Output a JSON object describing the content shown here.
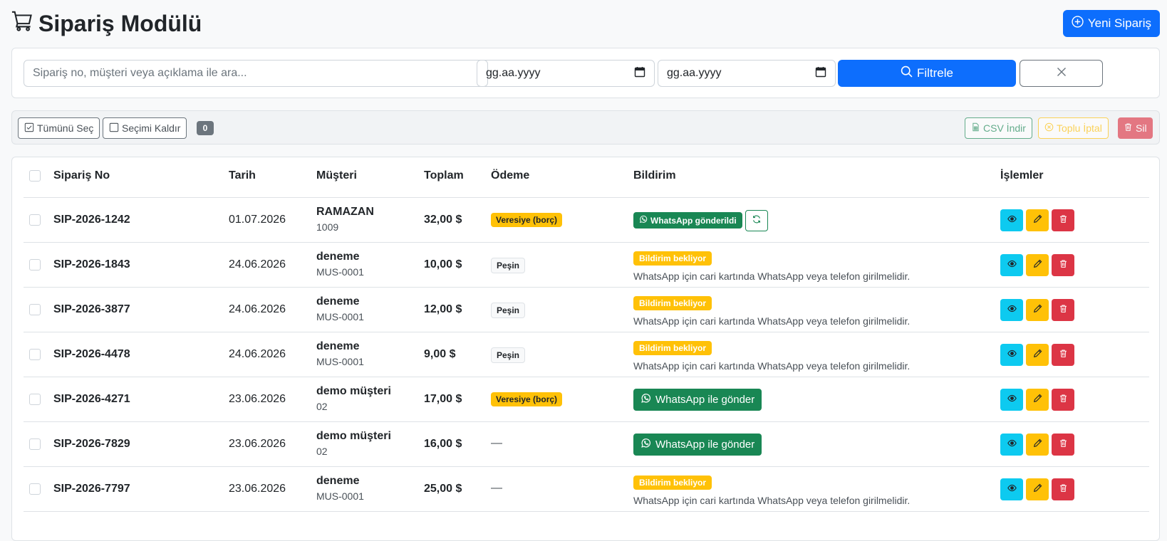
{
  "header": {
    "title": "Sipariş Modülü",
    "new_order_label": "Yeni Sipariş"
  },
  "filters": {
    "search_placeholder": "Sipariş no, müşteri veya açıklama ile ara...",
    "date_start_value": "gg.aa.yyyy",
    "date_end_value": "gg.aa.yyyy",
    "filter_label": "Filtrele"
  },
  "bulk": {
    "select_all_label": "Tümünü Seç",
    "clear_selection_label": "Seçimi Kaldır",
    "selected_count": "0",
    "csv_label": "CSV İndir",
    "bulk_cancel_label": "Toplu İptal",
    "delete_label": "Sil"
  },
  "table": {
    "columns": {
      "order_no": "Sipariş No",
      "date": "Tarih",
      "customer": "Müşteri",
      "total": "Toplam",
      "payment": "Ödeme",
      "notification": "Bildirim",
      "actions": "İşlemler"
    },
    "rows": [
      {
        "order_no": "SIP-2026-1242",
        "date": "01.07.2026",
        "customer": "RAMAZAN",
        "customer_code": "1009",
        "total": "32,00 $",
        "payment": "Veresiye (borç)",
        "payment_type": "credit",
        "notification": "WhatsApp gönderildi",
        "notification_type": "sent"
      },
      {
        "order_no": "SIP-2026-1843",
        "date": "24.06.2026",
        "customer": "deneme",
        "customer_code": "MUS-0001",
        "total": "10,00 $",
        "payment": "Peşin",
        "payment_type": "cash",
        "notification": "Bildirim bekliyor",
        "notification_help": "WhatsApp için cari kartında WhatsApp veya telefon girilmelidir.",
        "notification_type": "pending"
      },
      {
        "order_no": "SIP-2026-3877",
        "date": "24.06.2026",
        "customer": "deneme",
        "customer_code": "MUS-0001",
        "total": "12,00 $",
        "payment": "Peşin",
        "payment_type": "cash",
        "notification": "Bildirim bekliyor",
        "notification_help": "WhatsApp için cari kartında WhatsApp veya telefon girilmelidir.",
        "notification_type": "pending"
      },
      {
        "order_no": "SIP-2026-4478",
        "date": "24.06.2026",
        "customer": "deneme",
        "customer_code": "MUS-0001",
        "total": "9,00 $",
        "payment": "Peşin",
        "payment_type": "cash",
        "notification": "Bildirim bekliyor",
        "notification_help": "WhatsApp için cari kartında WhatsApp veya telefon girilmelidir.",
        "notification_type": "pending"
      },
      {
        "order_no": "SIP-2026-4271",
        "date": "23.06.2026",
        "customer": "demo müşteri",
        "customer_code": "02",
        "total": "17,00 $",
        "payment": "Veresiye (borç)",
        "payment_type": "credit",
        "notification": "WhatsApp ile gönder",
        "notification_type": "send"
      },
      {
        "order_no": "SIP-2026-7829",
        "date": "23.06.2026",
        "customer": "demo müşteri",
        "customer_code": "02",
        "total": "16,00 $",
        "payment": "—",
        "payment_type": "none",
        "notification": "WhatsApp ile gönder",
        "notification_type": "send"
      },
      {
        "order_no": "SIP-2026-7797",
        "date": "23.06.2026",
        "customer": "deneme",
        "customer_code": "MUS-0001",
        "total": "25,00 $",
        "payment": "—",
        "payment_type": "none",
        "notification": "Bildirim bekliyor",
        "notification_help": "WhatsApp için cari kartında WhatsApp veya telefon girilmelidir.",
        "notification_type": "pending"
      }
    ]
  }
}
